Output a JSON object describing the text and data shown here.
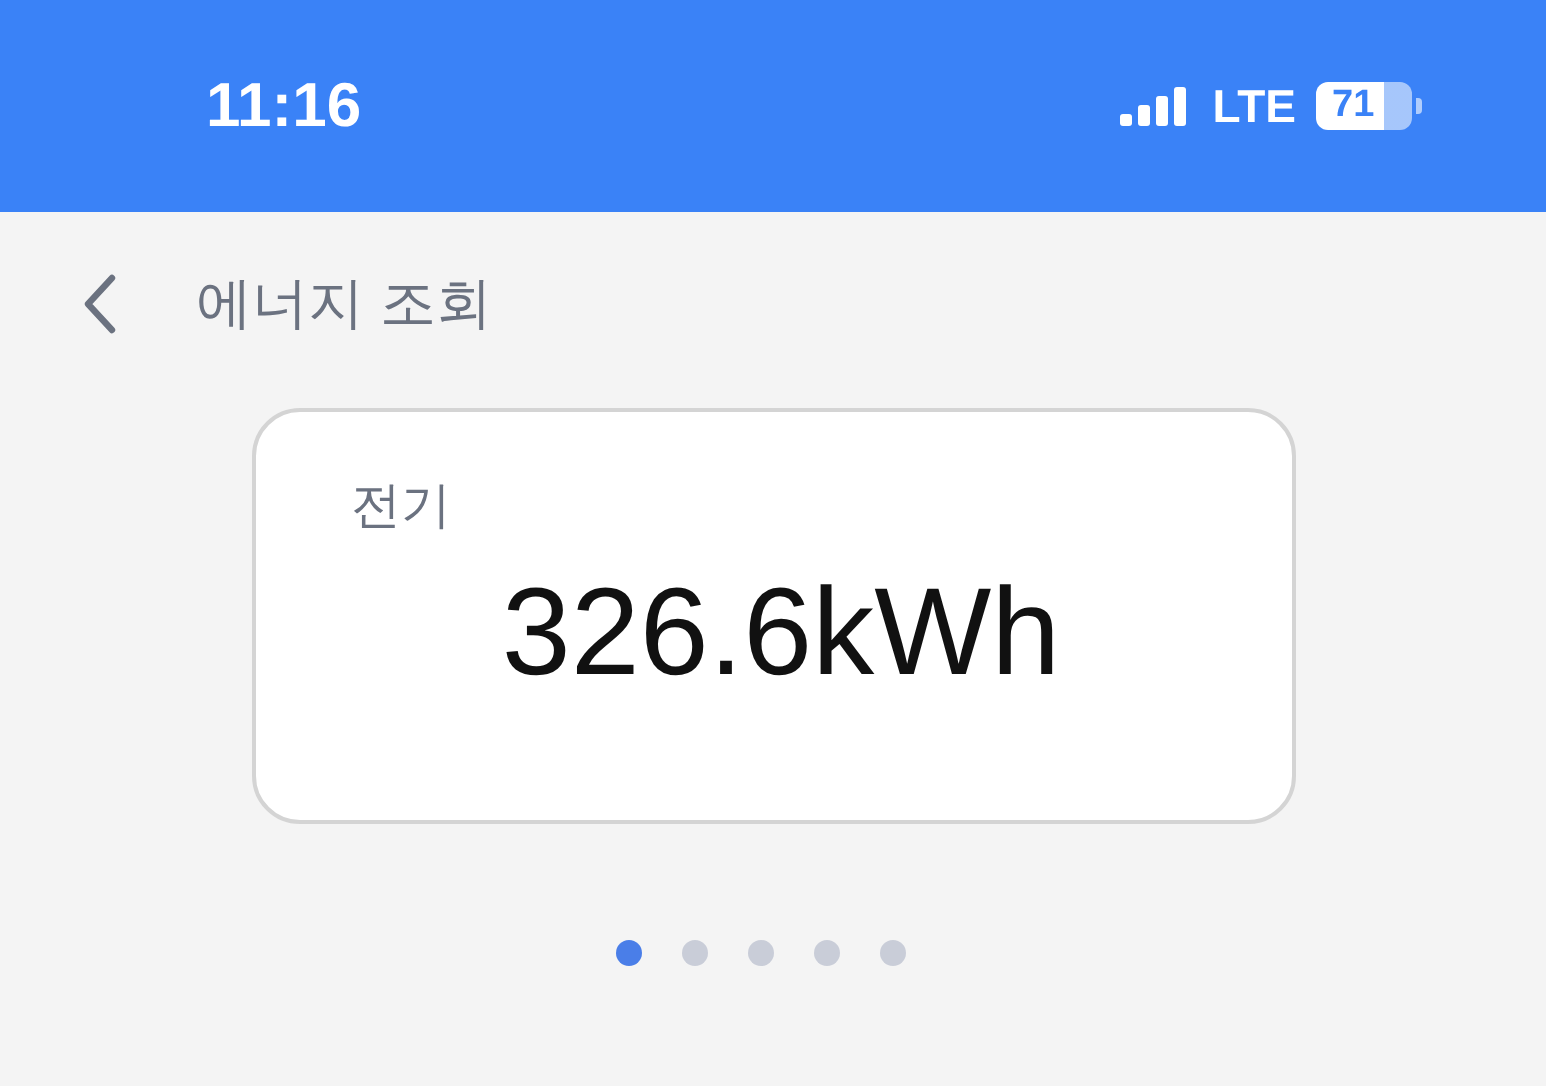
{
  "status_bar": {
    "time": "11:16",
    "network": "LTE",
    "battery": "71"
  },
  "header": {
    "title": "에너지 조회"
  },
  "card": {
    "label": "전기",
    "value": "326.6kWh"
  },
  "pager": [
    {
      "selected": true
    },
    {
      "selected": false
    },
    {
      "selected": false
    },
    {
      "selected": false
    },
    {
      "selected": false
    }
  ]
}
